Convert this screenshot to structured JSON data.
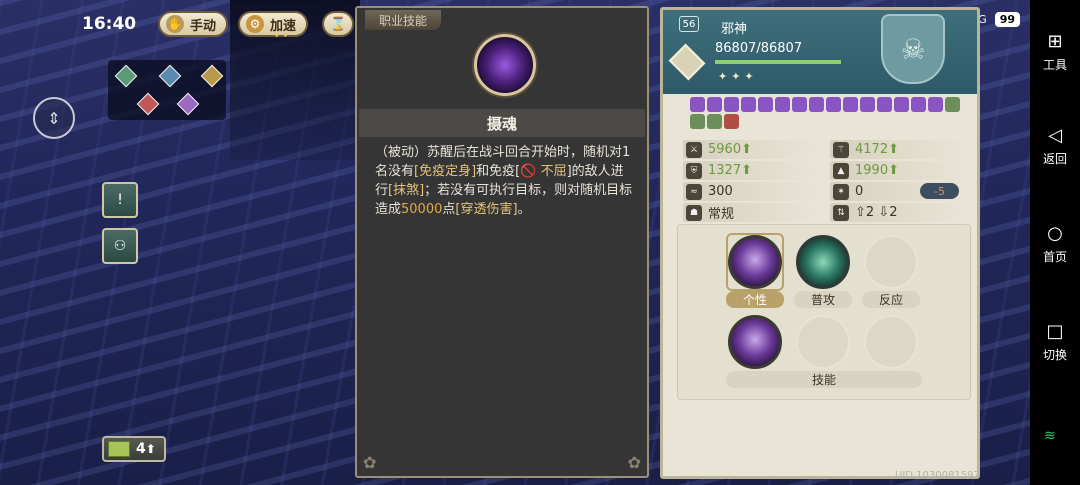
{
  "status_bar": {
    "time": "16:40",
    "signal1": "4G",
    "signal2": "4G",
    "battery": "99"
  },
  "top_controls": {
    "manual_label": "手动",
    "speed_label": "加速"
  },
  "resource": {
    "count": "4"
  },
  "skill_panel": {
    "tab_label": "职业技能",
    "title": "摄魂",
    "desc_parts": {
      "p1": "（被动）苏醒后在战斗回合开始时，随机对1名没有",
      "immune_control": "[免疫定身]",
      "p2": "和免疫[",
      "unyielding": "🚫 不屈",
      "p3": "]的敌人进行",
      "strike": "[抹煞]",
      "p4": "；若没有可执行目标，则对随机目标造成",
      "damage": "50000",
      "p5": "点",
      "pierce": "[穿透伤害]",
      "p6": "。"
    }
  },
  "character": {
    "level": "56",
    "name": "邪神",
    "hp": "86807/86807",
    "hp_fraction": 1.0,
    "stars": "✦✦✦",
    "stats": {
      "attack": "5960",
      "magic_attack": "4172",
      "defense": "1327",
      "magic_defense": "1990",
      "speed": "300",
      "crit": "0",
      "crit_mod": "-5",
      "type": "常规",
      "moves": "⇧2 ⇩2"
    },
    "slots": {
      "personality_label": "个性",
      "attack_label": "普攻",
      "reaction_label": "反应",
      "skill_label": "技能"
    }
  },
  "uid": "UID 1030081597",
  "navbar": {
    "tools": "工具",
    "back": "返回",
    "home": "首页",
    "switch": "切换"
  }
}
